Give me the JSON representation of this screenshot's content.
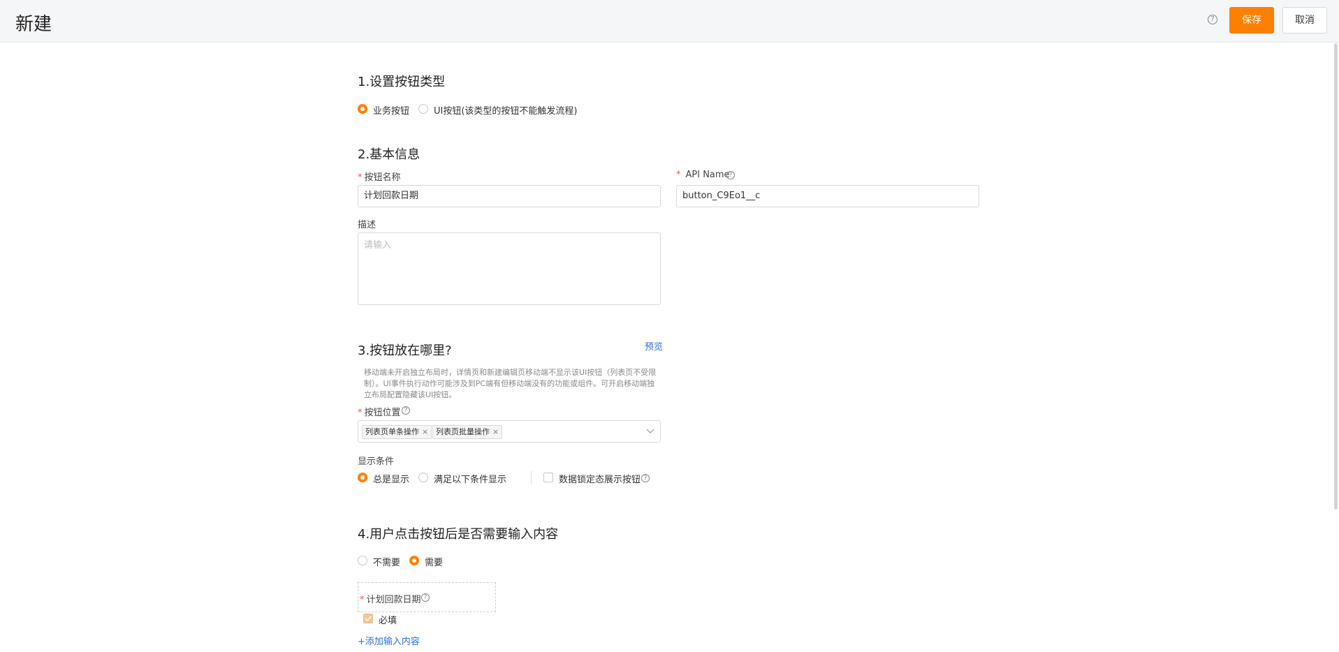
{
  "header": {
    "title": "新建",
    "help_glyph": "?",
    "save_label": "保存",
    "cancel_label": "取消"
  },
  "section1": {
    "title": "1.设置按钮类型",
    "options": [
      {
        "label": "业务按钮",
        "selected": true
      },
      {
        "label": "UI按钮(该类型的按钮不能触发流程)",
        "selected": false
      }
    ]
  },
  "section2": {
    "title": "2.基本信息",
    "name_label": "按钮名称",
    "name_value": "计划回款日期",
    "api_label": "API Name",
    "api_value": "button_C9Eo1__c",
    "desc_label": "描述",
    "desc_placeholder": "请输入",
    "required_mark": "*"
  },
  "section3": {
    "title": "3.按钮放在哪里?",
    "preview_label": "预览",
    "hint": "移动端未开启独立布局时，详情页和新建编辑页移动端不显示该UI按钮（列表页不受限制）。UI事件执行动作可能涉及到PC端有但移动端没有的功能或组件。可开启移动端独立布局配置隐藏该UI按钮。",
    "position_label": "按钮位置",
    "position_tags": [
      "列表页单条操作",
      "列表页批量操作"
    ],
    "tag_remove_glyph": "×",
    "display_label": "显示条件",
    "display_options": [
      {
        "label": "总是显示",
        "selected": true
      },
      {
        "label": "满足以下条件显示",
        "selected": false
      }
    ],
    "lock_checkbox_label": "数据锁定态展示按钮",
    "lock_checked": false
  },
  "section4": {
    "title": "4.用户点击按钮后是否需要输入内容",
    "options": [
      {
        "label": "不需要",
        "selected": false
      },
      {
        "label": "需要",
        "selected": true
      }
    ],
    "field_label": "计划回款日期",
    "required_label": "必填",
    "required_checked": true,
    "add_input_label": "+添加输入内容"
  },
  "colors": {
    "accent": "#ff8000",
    "link": "#2b6fd8",
    "required": "#ff4d4f"
  }
}
